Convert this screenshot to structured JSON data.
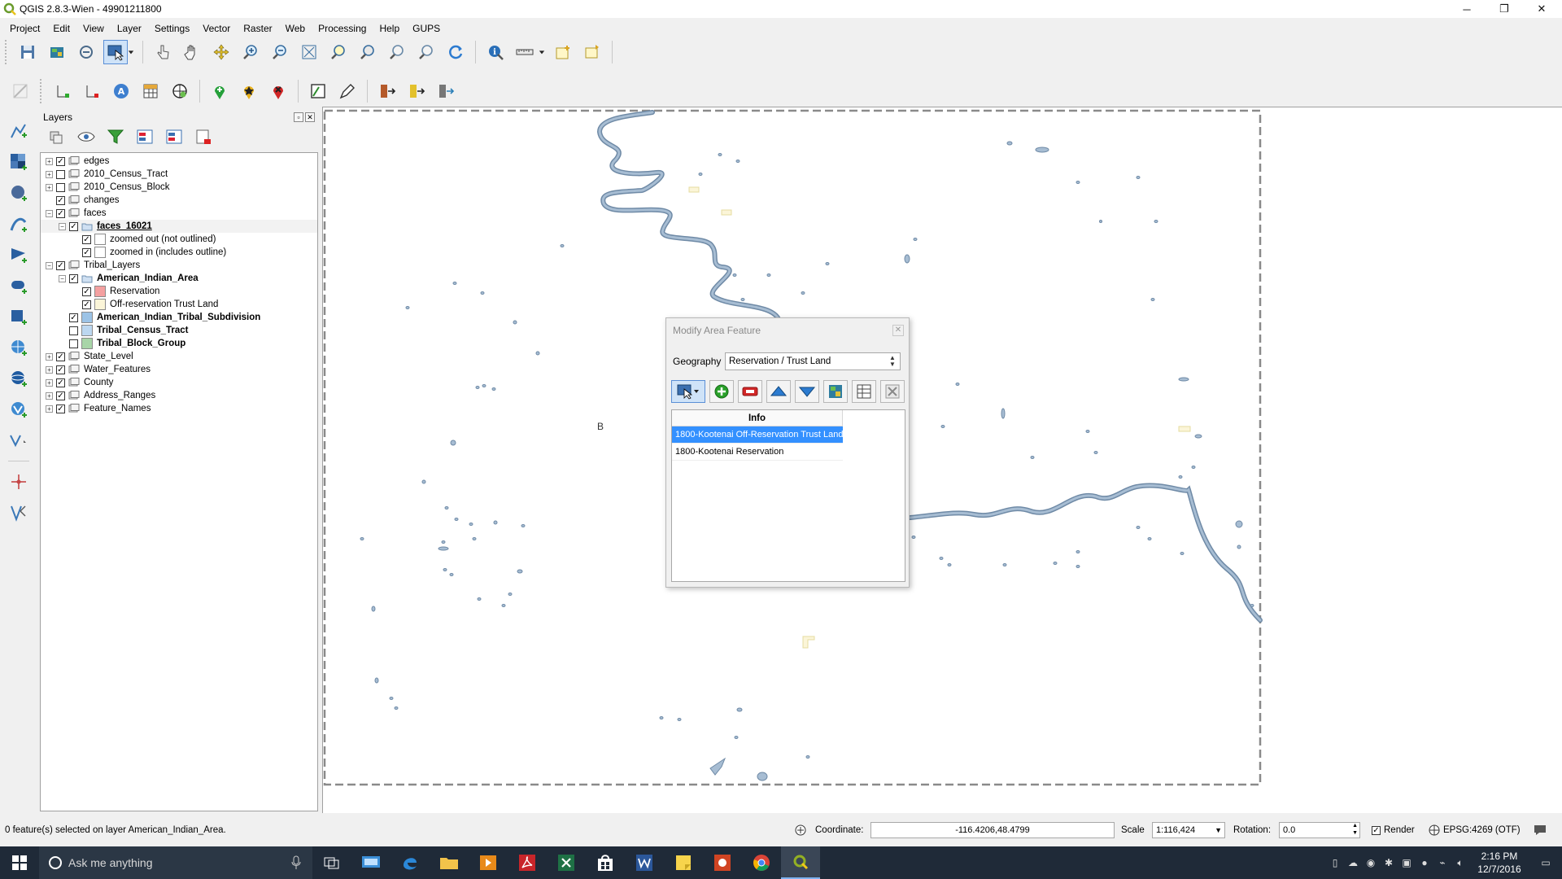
{
  "window": {
    "title": "QGIS 2.8.3-Wien - 49901211800",
    "minimize": "─",
    "maximize": "❐",
    "close": "✕"
  },
  "menu": [
    "Project",
    "Edit",
    "View",
    "Layer",
    "Settings",
    "Vector",
    "Raster",
    "Web",
    "Processing",
    "Help",
    "GUPS"
  ],
  "toolbar1": [
    {
      "name": "save-project-icon"
    },
    {
      "name": "open-project-icon"
    },
    {
      "name": "new-project-icon"
    },
    {
      "name": "select-features-icon",
      "pressed": true
    },
    {
      "name": "touch-zoom-icon"
    },
    {
      "name": "pan-map-icon"
    },
    {
      "name": "pan-to-selection-icon"
    },
    {
      "name": "zoom-in-icon"
    },
    {
      "name": "zoom-out-icon"
    },
    {
      "name": "zoom-full-icon"
    },
    {
      "name": "zoom-to-selection-icon"
    },
    {
      "name": "zoom-to-layer-icon"
    },
    {
      "name": "zoom-last-icon"
    },
    {
      "name": "zoom-next-icon"
    },
    {
      "name": "refresh-icon"
    },
    {
      "name": "identify-icon"
    },
    {
      "name": "measure-icon"
    },
    {
      "name": "new-bookmark-icon"
    },
    {
      "name": "show-bookmarks-icon"
    }
  ],
  "layers_panel": {
    "title": "Layers",
    "float_btn": "▫",
    "close_btn": "✕",
    "tree": [
      {
        "label": "edges",
        "level": 0,
        "exp": "+",
        "checked": true,
        "icon": "group"
      },
      {
        "label": "2010_Census_Tract",
        "level": 0,
        "exp": "+",
        "checked": false,
        "icon": "group"
      },
      {
        "label": "2010_Census_Block",
        "level": 0,
        "exp": "+",
        "checked": false,
        "icon": "group"
      },
      {
        "label": "changes",
        "level": 0,
        "exp": "",
        "checked": true,
        "icon": "group"
      },
      {
        "label": "faces",
        "level": 0,
        "exp": "−",
        "checked": true,
        "icon": "group"
      },
      {
        "label": "faces_16021",
        "level": 1,
        "exp": "−",
        "checked": true,
        "icon": "vector",
        "bold": true,
        "underline": true,
        "highlight": true
      },
      {
        "label": "zoomed out (not outlined)",
        "level": 2,
        "exp": "",
        "checked": true,
        "swatch": "#ffffff"
      },
      {
        "label": "zoomed in (includes outline)",
        "level": 2,
        "exp": "",
        "checked": true,
        "swatch": "#ffffff"
      },
      {
        "label": "Tribal_Layers",
        "level": 0,
        "exp": "−",
        "checked": true,
        "icon": "group"
      },
      {
        "label": "American_Indian_Area",
        "level": 1,
        "exp": "−",
        "checked": true,
        "icon": "vector",
        "bold": true
      },
      {
        "label": "Reservation",
        "level": 2,
        "exp": "",
        "checked": true,
        "swatch": "#f4a0a0"
      },
      {
        "label": "Off-reservation Trust Land",
        "level": 2,
        "exp": "",
        "checked": true,
        "swatch": "#fbf5d8"
      },
      {
        "label": "American_Indian_Tribal_Subdivision",
        "level": 1,
        "exp": "",
        "checked": true,
        "swatch": "#9cc3e6",
        "bold": true
      },
      {
        "label": "Tribal_Census_Tract",
        "level": 1,
        "exp": "",
        "checked": false,
        "swatch": "#bcd7f0",
        "bold": true
      },
      {
        "label": "Tribal_Block_Group",
        "level": 1,
        "exp": "",
        "checked": false,
        "swatch": "#a8d5a8",
        "bold": true
      },
      {
        "label": "State_Level",
        "level": 0,
        "exp": "+",
        "checked": true,
        "icon": "group"
      },
      {
        "label": "Water_Features",
        "level": 0,
        "exp": "+",
        "checked": true,
        "icon": "group"
      },
      {
        "label": "County",
        "level": 0,
        "exp": "+",
        "checked": true,
        "icon": "group"
      },
      {
        "label": "Address_Ranges",
        "level": 0,
        "exp": "+",
        "checked": true,
        "icon": "group"
      },
      {
        "label": "Feature_Names",
        "level": 0,
        "exp": "+",
        "checked": true,
        "icon": "group"
      }
    ]
  },
  "dialog": {
    "title": "Modify Area Feature",
    "close": "✕",
    "geography_label": "Geography",
    "geography_value": "Reservation / Trust Land",
    "list_header": "Info",
    "items": [
      {
        "label": "1800-Kootenai Off-Reservation Trust Land",
        "selected": true
      },
      {
        "label": "1800-Kootenai Reservation",
        "selected": false
      }
    ]
  },
  "map": {
    "partial_label": "B",
    "water_color": "#a7bdd3",
    "water_edge": "#6f8aa6",
    "frame_color": "#8a8a8a"
  },
  "status": {
    "message": "0 feature(s) selected on layer American_Indian_Area.",
    "coordinate_label": "Coordinate:",
    "coordinate_value": "-116.4206,48.4799",
    "scale_label": "Scale",
    "scale_value": "1:116,424",
    "rotation_label": "Rotation:",
    "rotation_value": "0.0",
    "render_label": "Render",
    "crs": "EPSG:4269 (OTF)"
  },
  "taskbar": {
    "search_placeholder": "Ask me anything",
    "time": "2:16 PM",
    "date": "12/7/2016"
  }
}
